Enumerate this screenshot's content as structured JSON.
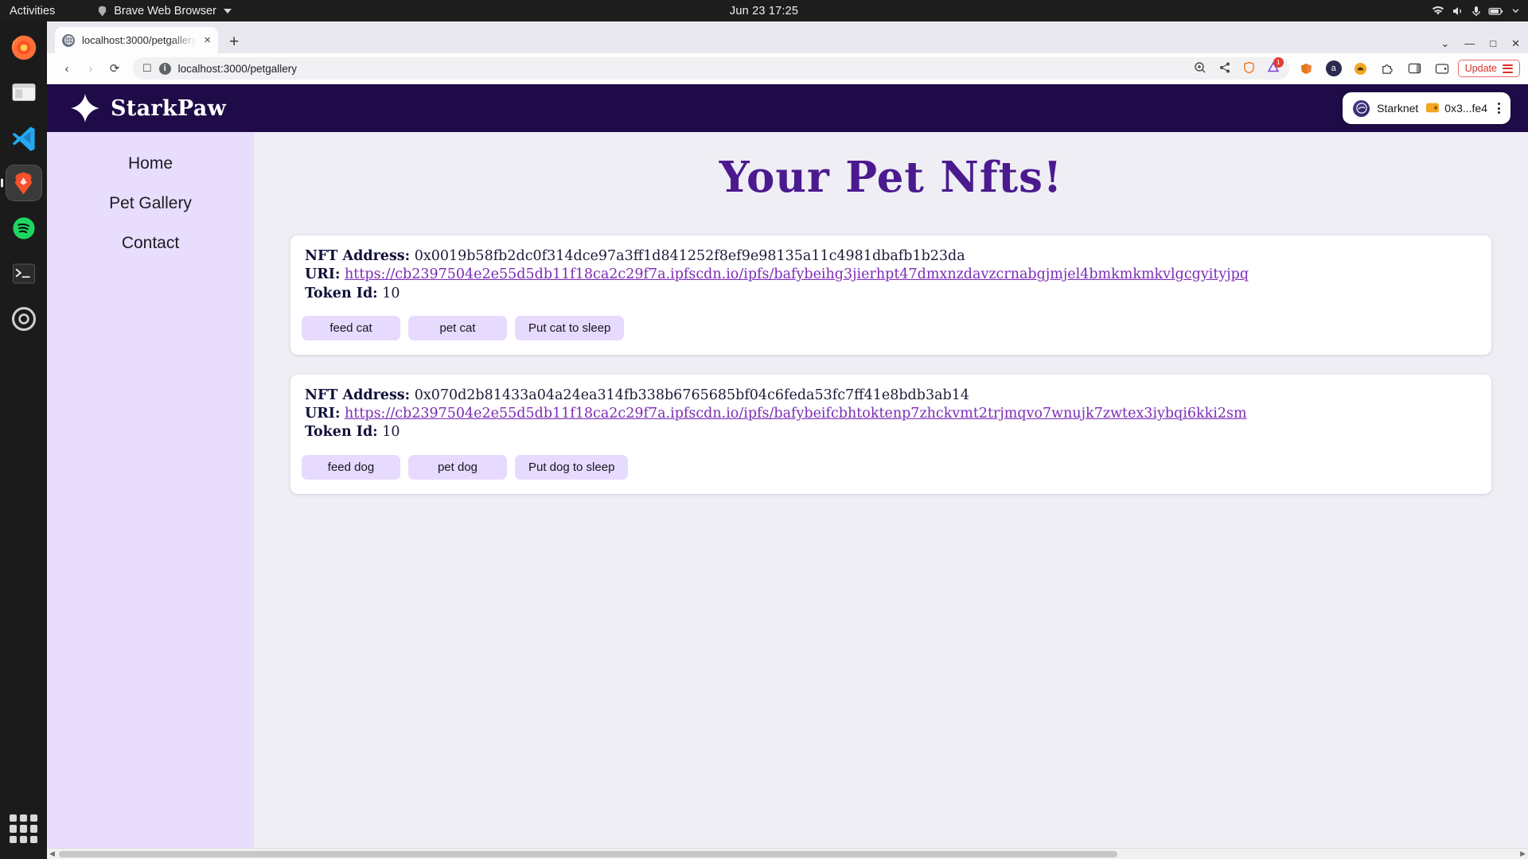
{
  "desktop": {
    "activities": "Activities",
    "app_menu": "Brave Web Browser",
    "clock": "Jun 23  17:25",
    "tray_icons": [
      "wifi-icon",
      "volume-icon",
      "microphone-icon",
      "battery-icon",
      "chevron-down-icon"
    ],
    "dock_items": [
      {
        "name": "firefox",
        "label": "Firefox"
      },
      {
        "name": "files",
        "label": "Files"
      },
      {
        "name": "vscode",
        "label": "Visual Studio Code"
      },
      {
        "name": "brave",
        "label": "Brave Web Browser"
      },
      {
        "name": "spotify",
        "label": "Spotify"
      },
      {
        "name": "terminal",
        "label": "Terminal"
      },
      {
        "name": "settings",
        "label": "Settings"
      }
    ],
    "show_apps": "Show Applications"
  },
  "browser": {
    "tab": {
      "title": "localhost:3000/petgallery",
      "favicon": "globe-icon",
      "close": "×"
    },
    "new_tab": "+",
    "window_controls": {
      "collapse": "⌄",
      "minimize": "—",
      "maximize": "□",
      "close": "✕"
    },
    "nav": {
      "back": "‹",
      "forward": "›",
      "reload": "⟳"
    },
    "url": "localhost:3000/petgallery",
    "url_icon": "info-icon",
    "bookmark_icon": "bookmark-icon",
    "toolbar_icons": [
      "zoom-icon",
      "share-icon",
      "brave-shields-icon",
      "brave-rewards-icon"
    ],
    "rewards_badge": "1",
    "extensions": [
      "metamask-icon",
      "argent-icon",
      "braavos-icon",
      "puzzle-icon",
      "sidebar-icon",
      "wallet-icon"
    ],
    "update_label": "Update",
    "menu_icon": "hamburger-menu-icon"
  },
  "site": {
    "brand": "StarkPaw",
    "logo": "four-point-star-icon",
    "wallet": {
      "network": "Starknet",
      "network_icon": "starknet-icon",
      "account_icon": "wallet-avatar-icon",
      "address": "0x3...fe4",
      "menu_icon": "kebab-menu-icon"
    },
    "sidebar": [
      {
        "label": "Home",
        "name": "sidebar-item-home"
      },
      {
        "label": "Pet Gallery",
        "name": "sidebar-item-pet-gallery"
      },
      {
        "label": "Contact",
        "name": "sidebar-item-contact"
      }
    ],
    "title": "Your Pet Nfts!",
    "labels": {
      "nft_address": "NFT Address:",
      "uri": "URI:",
      "token_id": "Token Id:"
    },
    "nfts": [
      {
        "address": "0x0019b58fb2dc0f314dce97a3ff1d841252f8ef9e98135a11c4981dbafb1b23da",
        "uri": "https://cb2397504e2e55d5db11f18ca2c29f7a.ipfscdn.io/ipfs/bafybeihg3jierhpt47dmxnzdavzcrnabgjmjel4bmkmkmkvlgcgyityjpq",
        "token_id": "10",
        "buttons": [
          "feed cat",
          "pet cat",
          "Put cat to sleep"
        ]
      },
      {
        "address": "0x070d2b81433a04a24ea314fb338b6765685bf04c6feda53fc7ff41e8bdb3ab14",
        "uri": "https://cb2397504e2e55d5db11f18ca2c29f7a.ipfscdn.io/ipfs/bafybeifcbhtoktenp7zhckvmt2trjmqvo7wnujk7zwtex3iybqi6kki2sm",
        "token_id": "10",
        "buttons": [
          "feed dog",
          "pet dog",
          "Put dog to sleep"
        ]
      }
    ]
  },
  "colors": {
    "header_bg": "#1e0b47",
    "sidebar_bg": "#e8ddfd",
    "page_bg": "#efeef4",
    "title": "#4b1a8f",
    "link": "#7b2bb5",
    "button_bg": "#e7daff"
  }
}
